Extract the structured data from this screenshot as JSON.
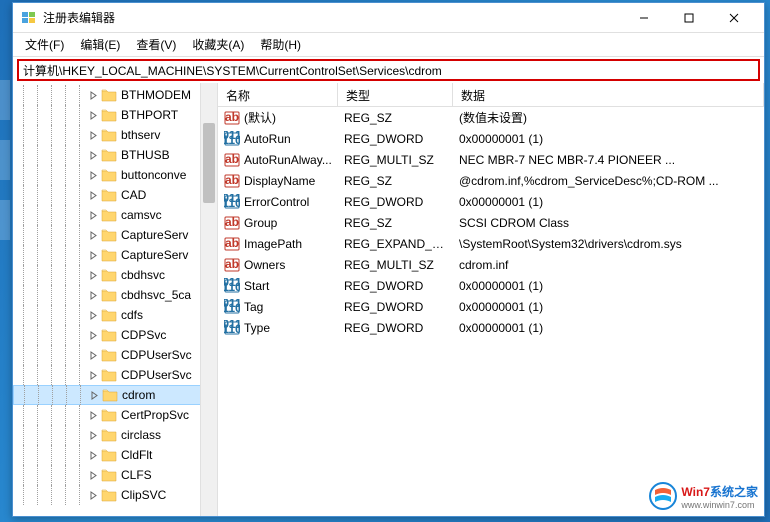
{
  "window": {
    "title": "注册表编辑器"
  },
  "menu": {
    "file": "文件(F)",
    "edit": "编辑(E)",
    "view": "查看(V)",
    "favorites": "收藏夹(A)",
    "help": "帮助(H)"
  },
  "address": "计算机\\HKEY_LOCAL_MACHINE\\SYSTEM\\CurrentControlSet\\Services\\cdrom",
  "tree": {
    "items": [
      {
        "label": "BTHMODEM",
        "selected": false
      },
      {
        "label": "BTHPORT",
        "selected": false
      },
      {
        "label": "bthserv",
        "selected": false
      },
      {
        "label": "BTHUSB",
        "selected": false
      },
      {
        "label": "buttonconve",
        "selected": false
      },
      {
        "label": "CAD",
        "selected": false
      },
      {
        "label": "camsvc",
        "selected": false
      },
      {
        "label": "CaptureServ",
        "selected": false
      },
      {
        "label": "CaptureServ",
        "selected": false
      },
      {
        "label": "cbdhsvc",
        "selected": false
      },
      {
        "label": "cbdhsvc_5ca",
        "selected": false
      },
      {
        "label": "cdfs",
        "selected": false
      },
      {
        "label": "CDPSvc",
        "selected": false
      },
      {
        "label": "CDPUserSvc",
        "selected": false
      },
      {
        "label": "CDPUserSvc",
        "selected": false
      },
      {
        "label": "cdrom",
        "selected": true
      },
      {
        "label": "CertPropSvc",
        "selected": false
      },
      {
        "label": "circlass",
        "selected": false
      },
      {
        "label": "CldFlt",
        "selected": false
      },
      {
        "label": "CLFS",
        "selected": false
      },
      {
        "label": "ClipSVC",
        "selected": false
      }
    ]
  },
  "list": {
    "headers": {
      "name": "名称",
      "type": "类型",
      "data": "数据"
    },
    "rows": [
      {
        "icon": "sz",
        "name": "(默认)",
        "type": "REG_SZ",
        "data": "(数值未设置)"
      },
      {
        "icon": "bin",
        "name": "AutoRun",
        "type": "REG_DWORD",
        "data": "0x00000001 (1)"
      },
      {
        "icon": "sz",
        "name": "AutoRunAlway...",
        "type": "REG_MULTI_SZ",
        "data": "NEC     MBR-7     NEC     MBR-7.4   PIONEER ..."
      },
      {
        "icon": "sz",
        "name": "DisplayName",
        "type": "REG_SZ",
        "data": "@cdrom.inf,%cdrom_ServiceDesc%;CD-ROM ..."
      },
      {
        "icon": "bin",
        "name": "ErrorControl",
        "type": "REG_DWORD",
        "data": "0x00000001 (1)"
      },
      {
        "icon": "sz",
        "name": "Group",
        "type": "REG_SZ",
        "data": "SCSI CDROM Class"
      },
      {
        "icon": "sz",
        "name": "ImagePath",
        "type": "REG_EXPAND_SZ",
        "data": "\\SystemRoot\\System32\\drivers\\cdrom.sys"
      },
      {
        "icon": "sz",
        "name": "Owners",
        "type": "REG_MULTI_SZ",
        "data": "cdrom.inf"
      },
      {
        "icon": "bin",
        "name": "Start",
        "type": "REG_DWORD",
        "data": "0x00000001 (1)"
      },
      {
        "icon": "bin",
        "name": "Tag",
        "type": "REG_DWORD",
        "data": "0x00000001 (1)"
      },
      {
        "icon": "bin",
        "name": "Type",
        "type": "REG_DWORD",
        "data": "0x00000001 (1)"
      }
    ]
  },
  "watermark": {
    "brand_red": "Win7",
    "brand_blue": "系统之家",
    "url": "www.winwin7.com"
  }
}
